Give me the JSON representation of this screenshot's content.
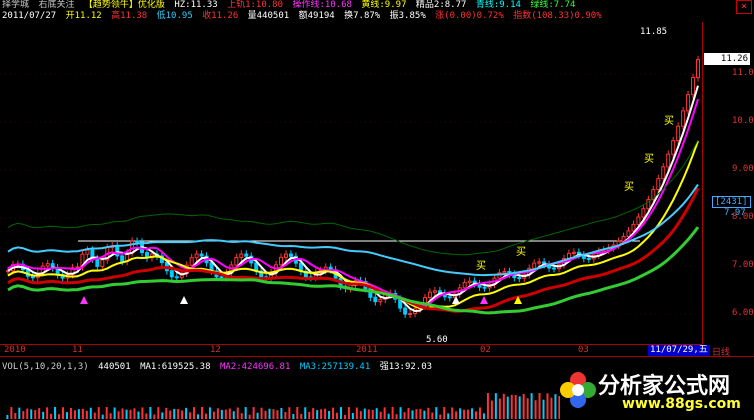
{
  "header": {
    "line1": [
      "择学城",
      "右底关注",
      "【趋势领牛】优化版",
      "HZ:11.33",
      "上轨1:10.80",
      "操作线:10.68",
      "黄线:9.97",
      "精品2:8.77",
      "青线:9.14",
      "绿线:7.74"
    ],
    "line1_colors": [
      "#ccc",
      "#ccc",
      "#ff0",
      "#fff",
      "#f33",
      "#f3f",
      "#ff0",
      "#fff",
      "#0ff",
      "#3f3"
    ],
    "line2": [
      "2011/07/27",
      "开11.12",
      "高11.38",
      "低10.95",
      "收11.26",
      "量440501",
      "额49194",
      "换7.87%",
      "振3.85%",
      "涨(0.00)0.72%",
      "指数(108.33)0.90%"
    ],
    "line2_colors": [
      "#fff",
      "#ff0",
      "#f33",
      "#3cf",
      "#f33",
      "#fff",
      "#fff",
      "#fff",
      "#fff",
      "#f33",
      "#f33"
    ]
  },
  "window": {
    "close_symbol": "×"
  },
  "price_axis": {
    "labels": [
      "11.00",
      "10.00",
      "9.00",
      "8.00",
      "7.00",
      "6.00"
    ],
    "current_price": "11.26"
  },
  "tags": {
    "box_value": "[2431]",
    "box_value2": "7.97"
  },
  "annotations": {
    "high": "11.85",
    "low": "5.60",
    "buy_marks": [
      "买",
      "买",
      "买",
      "买",
      "买"
    ]
  },
  "date_axis": {
    "labels": [
      "2010",
      "11",
      "12",
      "2011",
      "02",
      "03"
    ],
    "current": "11/07/29,五",
    "unit": "日线"
  },
  "volume": {
    "items": [
      "VOL(5,10,20,1,3)",
      "440501",
      "MA1:619525.38",
      "MA2:424696.81",
      "MA3:257139.41",
      "强13:92.03"
    ],
    "colors": [
      "#ccc",
      "#fff",
      "#fff",
      "#f3f",
      "#0cf",
      "#fff"
    ]
  },
  "logo": {
    "text": "分析家公式网",
    "url": "www.88gs.com"
  }
}
